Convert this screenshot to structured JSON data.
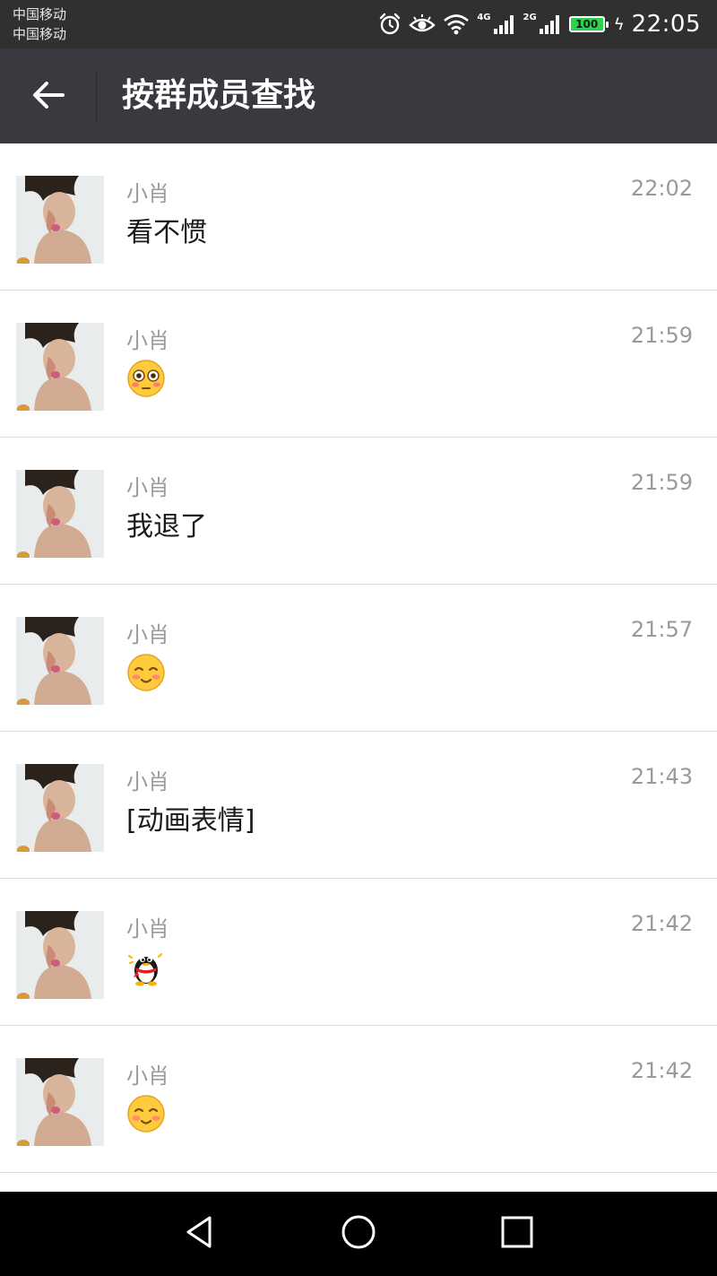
{
  "status_bar": {
    "carrier_1": "中国移动",
    "carrier_2": "中国移动",
    "net_1": "4G",
    "net_2": "2G",
    "battery": "100",
    "time": "22:05",
    "icons": [
      "alarm-icon",
      "eye-icon",
      "wifi-icon",
      "signal-icon",
      "signal-icon",
      "battery-icon",
      "charging-icon"
    ]
  },
  "header": {
    "title": "按群成员查找",
    "back_icon": "arrow-left-icon"
  },
  "messages": [
    {
      "sender": "小肖",
      "time": "22:02",
      "type": "text",
      "text": "看不惯"
    },
    {
      "sender": "小肖",
      "time": "21:59",
      "type": "emoji",
      "emoji": "flushed-face-icon"
    },
    {
      "sender": "小肖",
      "time": "21:59",
      "type": "text",
      "text": "我退了"
    },
    {
      "sender": "小肖",
      "time": "21:57",
      "type": "emoji",
      "emoji": "shy-smile-face-icon"
    },
    {
      "sender": "小肖",
      "time": "21:43",
      "type": "text",
      "text": "[动画表情]"
    },
    {
      "sender": "小肖",
      "time": "21:42",
      "type": "emoji",
      "emoji": "penguin-icon"
    },
    {
      "sender": "小肖",
      "time": "21:42",
      "type": "emoji",
      "emoji": "shy-smile-face-icon"
    }
  ],
  "nav_bar": {
    "buttons": [
      "back-triangle-icon",
      "home-circle-icon",
      "recents-square-icon"
    ]
  },
  "colors": {
    "status_bar_bg": "#303030",
    "action_bar_bg": "#393a3f",
    "meta_text": "#9a9a9a",
    "divider": "#dcdcdc",
    "battery_fill": "#2bd34a"
  }
}
